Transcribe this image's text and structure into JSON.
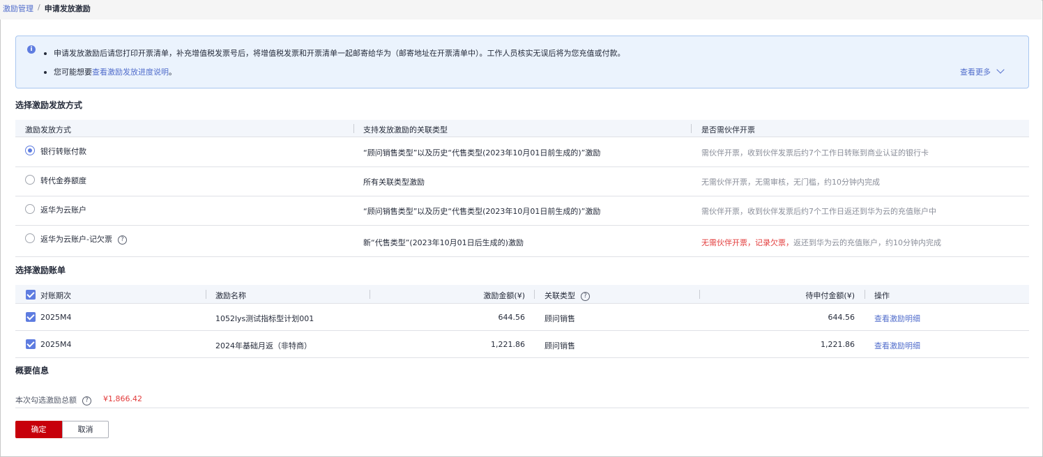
{
  "breadcrumb": {
    "parent": "激励管理",
    "separator": "/",
    "current": "申请发放激励"
  },
  "notice": {
    "line1": "申请发放激励后请您打印开票清单，补充增值税发票号后，将增值税发票和开票清单一起邮寄给华为（邮寄地址在开票清单中）。工作人员核实无误后将为您充值或付款。",
    "line2_prefix": "您可能想要",
    "line2_link": "查看激励发放进度说明",
    "line2_suffix": "。",
    "more": "查看更多"
  },
  "method_section": {
    "title": "选择激励发放方式",
    "headers": [
      "激励发放方式",
      "支持发放激励的关联类型",
      "是否需伙伴开票"
    ],
    "rows": [
      {
        "name": "银行转账付款",
        "selected": true,
        "types": "“顾问销售类型”以及历史“代售类型(2023年10月01日前生成的)”激励",
        "invoice": "需伙伴开票，收到伙伴发票后约7个工作日转账到商业认证的银行卡"
      },
      {
        "name": "转代金券额度",
        "selected": false,
        "types": "所有关联类型激励",
        "invoice": "无需伙伴开票，无需审核，无门槛，约10分钟内完成"
      },
      {
        "name": "返华为云账户",
        "selected": false,
        "types": "“顾问销售类型”以及历史“代售类型(2023年10月01日前生成的)”激励",
        "invoice": "需伙伴开票，收到伙伴发票后约7个工作日返还到华为云的充值账户中"
      },
      {
        "name": "返华为云账户-记欠票",
        "selected": false,
        "types": "新“代售类型”(2023年10月01日后生成的)激励",
        "invoice_red": "无需伙伴开票，记录欠票，",
        "invoice_rest": "返还到华为云的充值账户，约10分钟内完成"
      }
    ]
  },
  "bill_section": {
    "title": "选择激励账单",
    "headers": [
      "对账期次",
      "激励名称",
      "激励金额(¥)",
      "关联类型",
      "待申付金额(¥)",
      "操作"
    ],
    "rows": [
      {
        "period": "2025M4",
        "name": "1052lys测试指标型计划001",
        "amount": "644.56",
        "type": "顾问销售",
        "pending": "644.56",
        "action": "查看激励明细"
      },
      {
        "period": "2025M4",
        "name": "2024年基础月返（非特商）",
        "amount": "1,221.86",
        "type": "顾问销售",
        "pending": "1,221.86",
        "action": "查看激励明细"
      }
    ]
  },
  "summary": {
    "title": "概要信息",
    "label": "本次勾选激励总额",
    "value": "¥1,866.42"
  },
  "buttons": {
    "confirm": "确定",
    "cancel": "取消"
  },
  "colors": {
    "primary": "#c7000b",
    "link": "#526ecc",
    "accent": "#5e7ce0",
    "error": "#e23b3b"
  },
  "icons": [
    "info-icon",
    "chevron-down-icon",
    "help-icon",
    "radio-icon",
    "checkbox-icon"
  ]
}
